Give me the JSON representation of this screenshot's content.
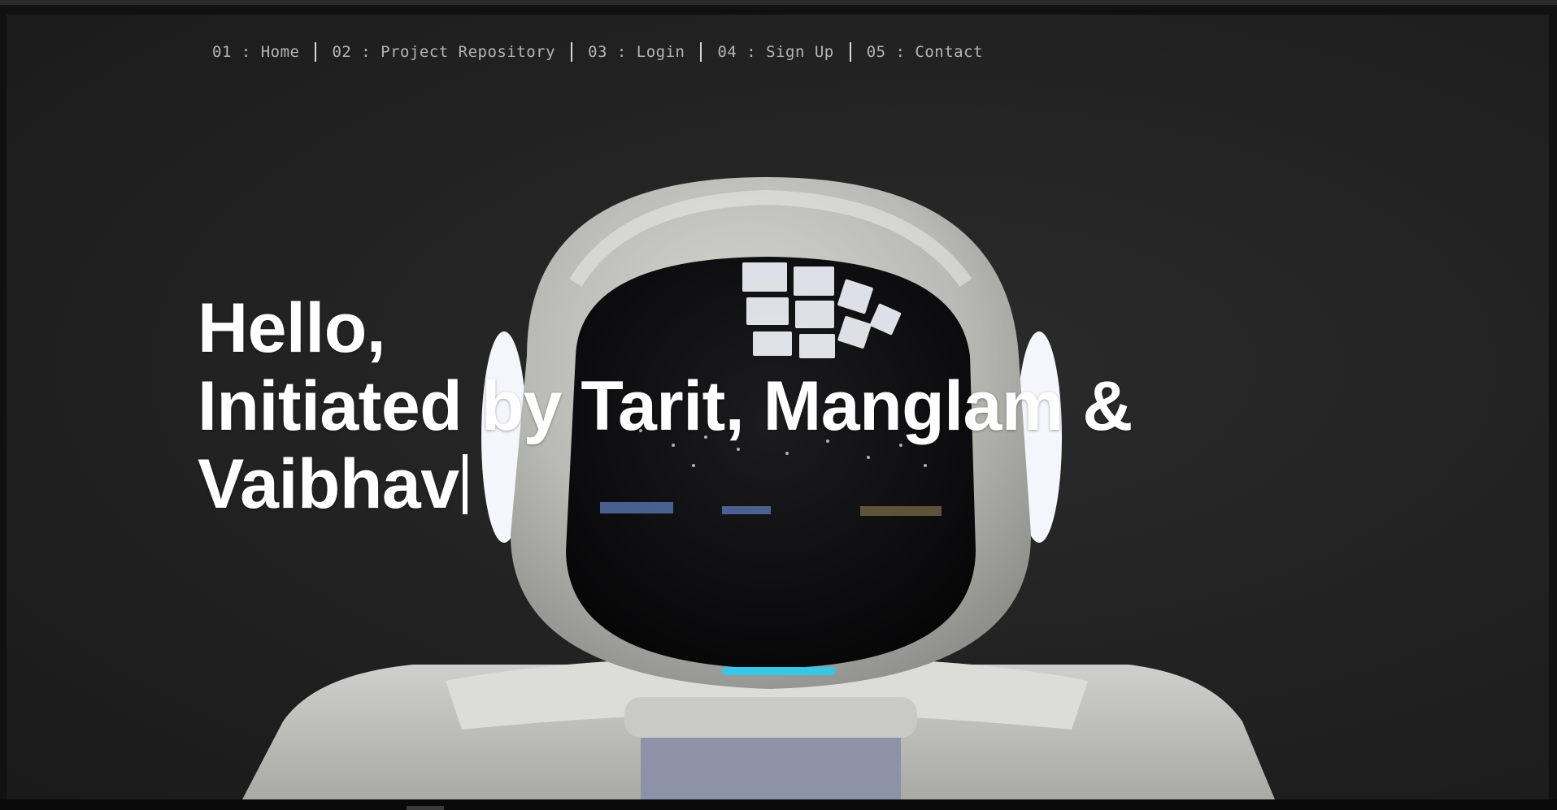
{
  "nav": {
    "items": [
      "01 : Home",
      "02 : Project Repository",
      "03 : Login",
      "04 : Sign Up",
      "05 : Contact"
    ]
  },
  "hero": {
    "line1": "Hello,",
    "line2": "Initiated by Tarit, Manglam &",
    "line3": "Vaibhav"
  },
  "colors": {
    "background": "#232323",
    "text": "#ffffff",
    "nav_text": "#b5b5b5",
    "visor_accent": "#35c6e8"
  }
}
